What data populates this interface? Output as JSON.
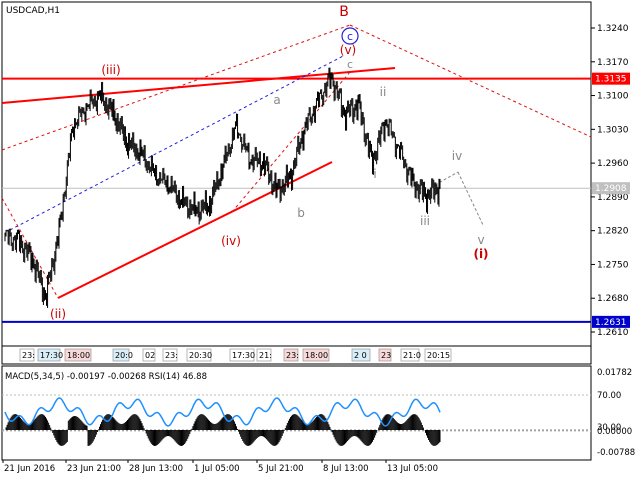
{
  "window": {
    "symbol_label": "USDCAD,H1"
  },
  "colors": {
    "bg": "#ffffff",
    "candle": "#000000",
    "frame": "#000000",
    "grid_label": "#000000",
    "support": "#ff0000",
    "blue_line": "#0000cc",
    "red_dash": "#e01010",
    "blue_dash": "#2020e0",
    "wave_red": "#cc0000",
    "wave_gray": "#888888",
    "rsi": "#1e90ff",
    "macd": "#000000",
    "current_price_bg": "#c0c0c0",
    "level_red_bg": "#ff0000",
    "level_blue_bg": "#0000cc"
  },
  "price_axis": {
    "ticks": [
      "1.3240",
      "1.3170",
      "1.3100",
      "1.3030",
      "1.2960",
      "1.2890",
      "1.2820",
      "1.2750",
      "1.2680",
      "1.2610"
    ],
    "current_price": "1.2908",
    "resistance_label": "1.3135",
    "support_label": "1.2631"
  },
  "wave_labels": {
    "B": "B",
    "c_circle": "c",
    "v_red": "(v)",
    "c_gray": "c",
    "iii_red": "(iii)",
    "a": "a",
    "ii": "ii",
    "i": "i",
    "iv_gray": "iv",
    "iv_red": "(iv)",
    "b": "b",
    "iii_gray": "iii",
    "v_gray": "v",
    "i_red": "(i)",
    "ii_red": "(ii)"
  },
  "session_labels": [
    "23:",
    "17:30",
    "18:00",
    "20:0",
    "02",
    "23:",
    "20:30",
    "17:30",
    "21:",
    "23:",
    "18:00",
    "2 0",
    "23",
    "21:0",
    "20:15"
  ],
  "indicator": {
    "title": "MACD(5,34,5) -0.00197 -0.00268 RSI(14) 46.88",
    "axis_ticks": [
      "0.01782",
      "70.00",
      "30.00",
      "0.00000",
      "-0.00788"
    ]
  },
  "time_axis": [
    "21 Jun 2016",
    "23 Jun 21:00",
    "28 Jun 13:00",
    "1 Jul 05:00",
    "5 Jul 21:00",
    "8 Jul 13:00",
    "13 Jul 05:00"
  ],
  "chart_data": {
    "type": "line",
    "title": "USDCAD,H1",
    "price_range": [
      1.259,
      1.326
    ],
    "close_path_hint": "approximate H1 closes",
    "x": [
      "21 Jun 2016",
      "23 Jun 21:00",
      "28 Jun 13:00",
      "1 Jul 05:00",
      "5 Jul 21:00",
      "8 Jul 13:00",
      "13 Jul 05:00"
    ],
    "series": [
      {
        "values": [
          1.281,
          1.28,
          1.276,
          1.268,
          1.282,
          1.304,
          1.308,
          1.31,
          1.306,
          1.3,
          1.298,
          1.294,
          1.292,
          1.288,
          1.286,
          1.287,
          1.295,
          1.304,
          1.297,
          1.296,
          1.29,
          1.293,
          1.303,
          1.309,
          1.314,
          1.306,
          1.308,
          1.296,
          1.305,
          1.299,
          1.292,
          1.289,
          1.291
        ]
      }
    ],
    "levels": {
      "resistance": 1.3135,
      "support": 1.2631,
      "current": 1.2908
    }
  }
}
